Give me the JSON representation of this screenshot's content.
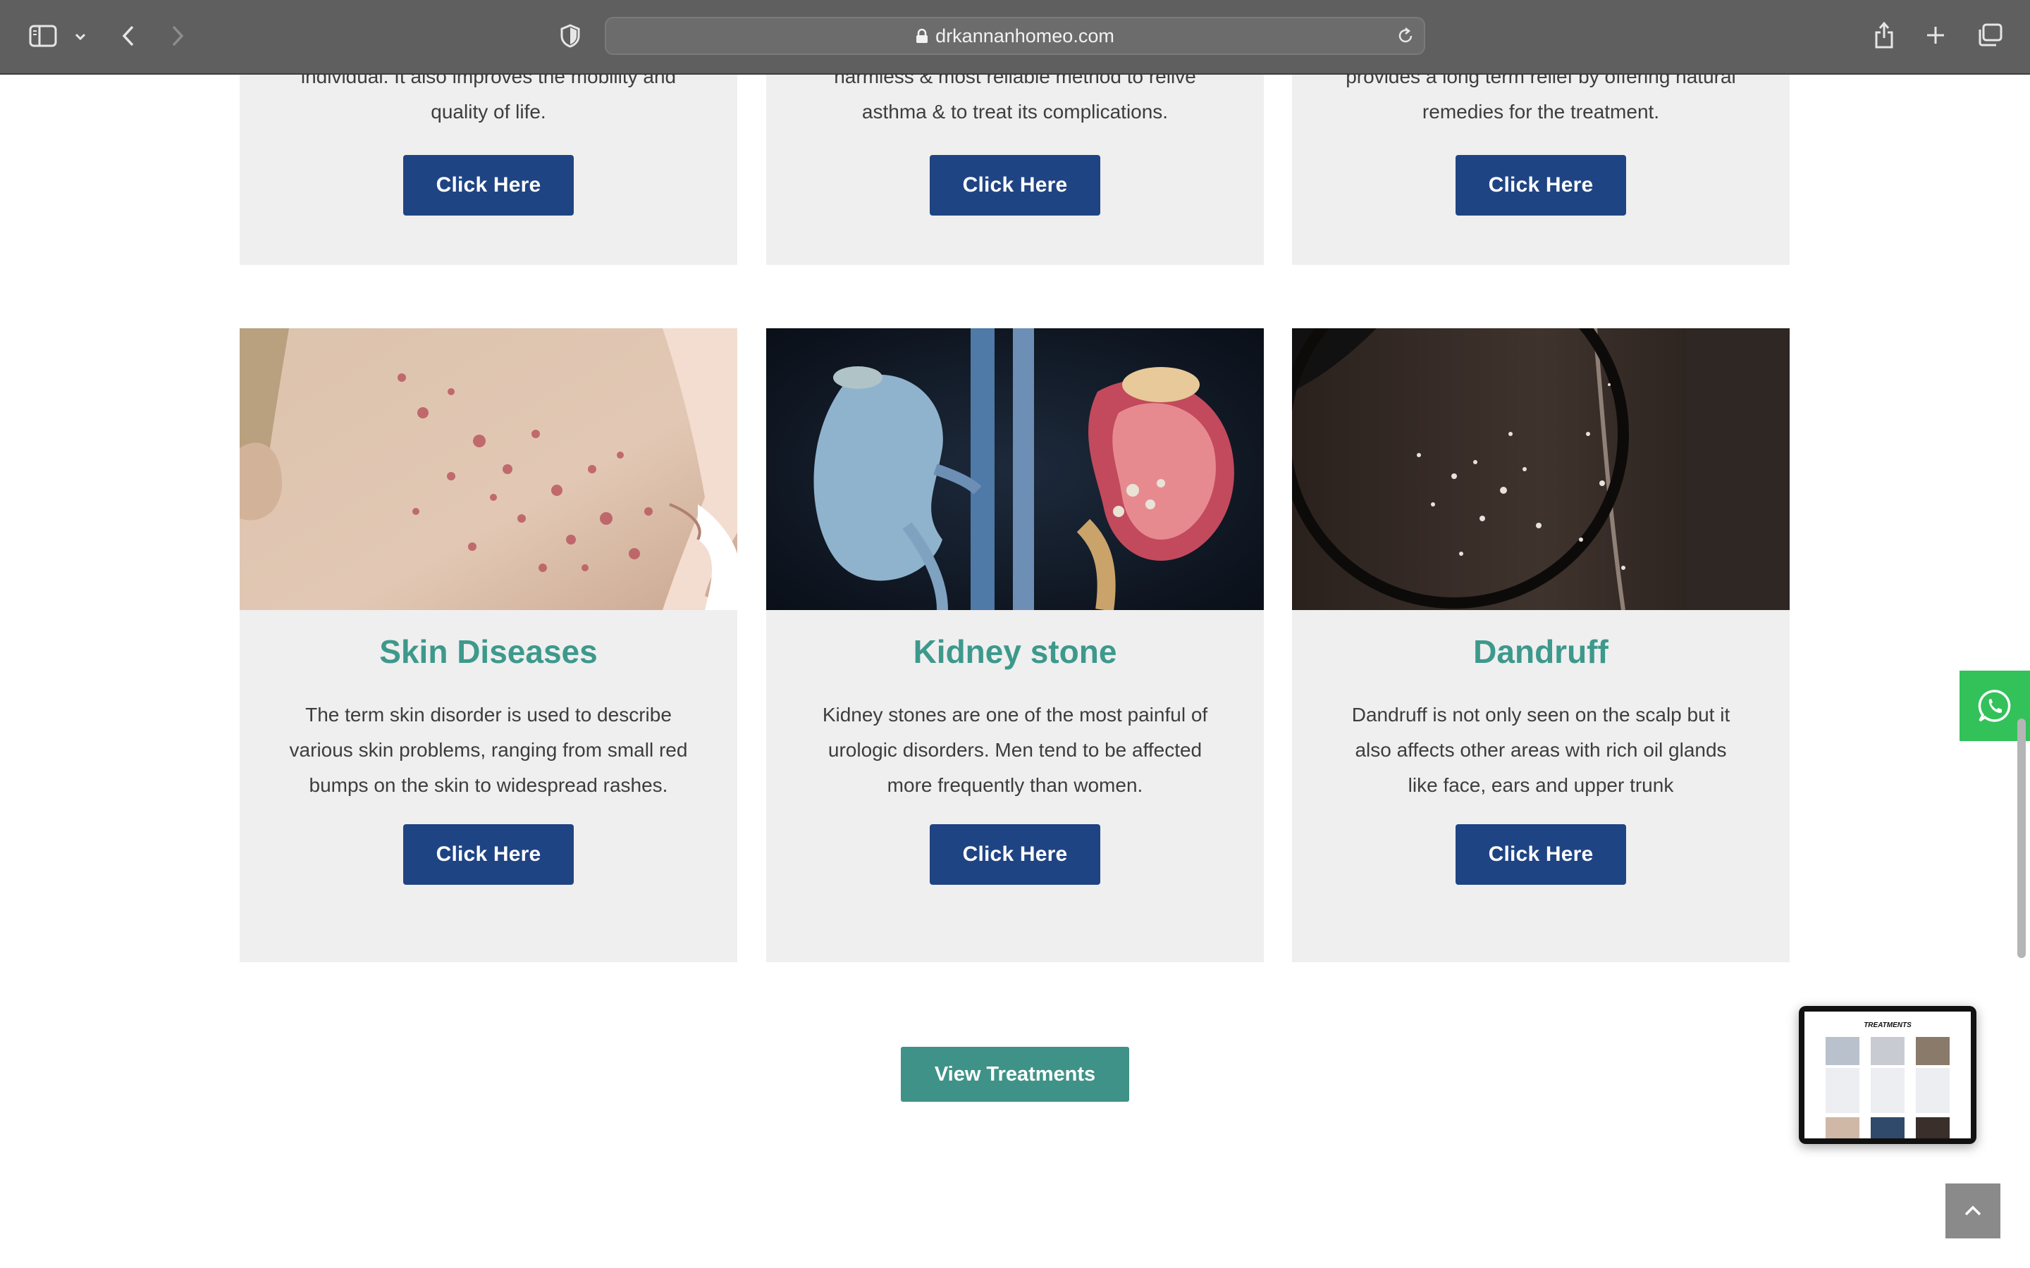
{
  "browser": {
    "url": "drkannanhomeo.com",
    "icons": {
      "sidebar": "sidebar-icon",
      "chevron": "chevron-down-icon",
      "back": "back-arrow-icon",
      "forward": "forward-arrow-icon",
      "shield": "privacy-shield-icon",
      "lock": "lock-icon",
      "reload": "reload-icon",
      "share": "share-icon",
      "new_tab": "plus-icon",
      "tabs": "tab-overview-icon"
    }
  },
  "top_cards": [
    {
      "desc_lines": [
        "individual. It also improves the mobility and",
        "quality of life."
      ],
      "button": "Click Here"
    },
    {
      "desc_lines": [
        "harmless & most reliable method to relive",
        "asthma & to treat its complications."
      ],
      "button": "Click Here"
    },
    {
      "desc_lines": [
        "provides a long term relief by offering natural",
        "remedies for the treatment."
      ],
      "button": "Click Here"
    }
  ],
  "treatments": [
    {
      "title": "Skin Diseases",
      "desc_lines": [
        "The term skin disorder is used to describe",
        "various skin problems, ranging from small red",
        "bumps on the skin to widespread rashes."
      ],
      "button": "Click Here",
      "image": "acne-skin-photo"
    },
    {
      "title": "Kidney stone",
      "desc_lines": [
        "Kidney stones are one of the most painful of",
        "urologic disorders. Men tend to be affected",
        "more frequently than women."
      ],
      "button": "Click Here",
      "image": "kidney-illustration"
    },
    {
      "title": "Dandruff",
      "desc_lines": [
        "Dandruff is not only seen on the scalp but it",
        "also affects other areas with rich oil glands",
        "like face, ears and upper trunk"
      ],
      "button": "Click Here",
      "image": "dandruff-scalp-photo"
    }
  ],
  "view_button": "View Treatments",
  "preview": {
    "title": "TREATMENTS"
  },
  "colors": {
    "button_blue": "#1f4484",
    "title_teal": "#3d998c",
    "view_button": "#3f9287",
    "whatsapp": "#33c15a",
    "card_bg": "#efefef"
  }
}
